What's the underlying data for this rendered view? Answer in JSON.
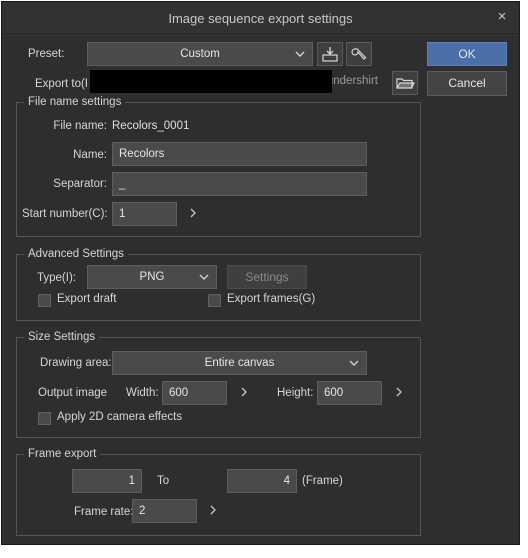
{
  "window": {
    "title": "Image sequence export settings",
    "close": "×"
  },
  "preset": {
    "label": "Preset:",
    "value": "Custom"
  },
  "export_to": {
    "label": "Export to(F):",
    "path_tail": "undershirt"
  },
  "buttons": {
    "ok": "OK",
    "cancel": "Cancel"
  },
  "file_name_settings": {
    "title": "File name settings",
    "file_name_label": "File name:",
    "file_name_value": "Recolors_0001",
    "name_label": "Name:",
    "name_value": "Recolors",
    "separator_label": "Separator:",
    "separator_value": "_",
    "start_number_label": "Start number(C):",
    "start_number_value": "1"
  },
  "advanced_settings": {
    "title": "Advanced Settings",
    "type_label": "Type(I):",
    "type_value": "PNG",
    "settings_button": "Settings",
    "export_draft": "Export draft",
    "export_draft_checked": false,
    "export_frames": "Export frames(G)",
    "export_frames_checked": false
  },
  "size_settings": {
    "title": "Size Settings",
    "drawing_area_label": "Drawing area:",
    "drawing_area_value": "Entire canvas",
    "output_image_label": "Output image",
    "width_label": "Width:",
    "width_value": "600",
    "height_label": "Height:",
    "height_value": "600",
    "apply_2d_camera": "Apply 2D camera effects",
    "apply_2d_camera_checked": false
  },
  "frame_export": {
    "title": "Frame export",
    "from_value": "1",
    "to_label": "To",
    "to_value": "4",
    "unit_label": "(Frame)",
    "frame_rate_label": "Frame rate:",
    "frame_rate_value": "2"
  },
  "icons": {
    "preset_register": "register-preset-icon",
    "preset_edit": "wrench-icon",
    "folder": "folder-open-icon",
    "chevron": "chevron-down-icon",
    "spin": "chevron-right-icon"
  }
}
